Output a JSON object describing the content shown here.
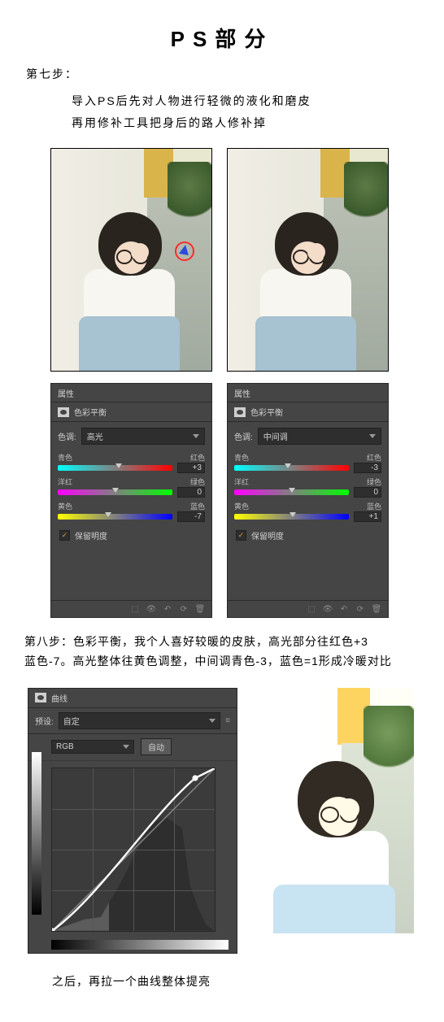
{
  "title": "PS部分",
  "step7": {
    "label": "第七步：",
    "line1": "导入PS后先对人物进行轻微的液化和磨皮",
    "line2": "再用修补工具把身后的路人修补掉"
  },
  "panels": {
    "header": "属性",
    "adjustment": "色彩平衡",
    "tone_label": "色调:",
    "left": {
      "tone": "高光",
      "cyan": "青色",
      "red": "红色",
      "cyan_red_val": "+3",
      "magenta": "洋红",
      "green": "绿色",
      "magenta_green_val": "0",
      "yellow": "黄色",
      "blue": "蓝色",
      "yellow_blue_val": "-7"
    },
    "right": {
      "tone": "中间调",
      "cyan": "青色",
      "red": "红色",
      "cyan_red_val": "-3",
      "magenta": "洋红",
      "green": "绿色",
      "magenta_green_val": "0",
      "yellow": "黄色",
      "blue": "蓝色",
      "yellow_blue_val": "+1"
    },
    "preserve": "保留明度"
  },
  "step8": {
    "line1": "第八步：色彩平衡，我个人喜好较暖的皮肤，高光部分往红色+3",
    "line2": "蓝色-7。高光整体往黄色调整，中间调青色-3，蓝色=1形成冷暖对比"
  },
  "curves": {
    "header": "曲线",
    "preset_label": "预设:",
    "preset_value": "自定",
    "channel": "RGB",
    "auto": "自动"
  },
  "final": "之后，再拉一个曲线整体提亮"
}
